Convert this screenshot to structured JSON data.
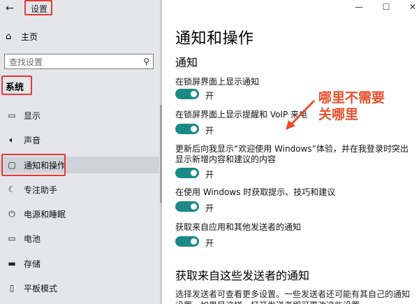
{
  "window": {
    "title": "设置",
    "controls": [
      "—",
      "☐",
      "✕"
    ]
  },
  "sidebar": {
    "back_icon": "back-arrow-icon",
    "home_label": "主页",
    "search_placeholder": "查找设置",
    "section_label": "系统",
    "items": [
      {
        "label": "显示",
        "icon": "display-icon"
      },
      {
        "label": "声音",
        "icon": "speaker-icon"
      },
      {
        "label": "通知和操作",
        "icon": "notification-icon",
        "active": true
      },
      {
        "label": "专注助手",
        "icon": "moon-icon"
      },
      {
        "label": "电源和睡眠",
        "icon": "power-icon"
      },
      {
        "label": "电池",
        "icon": "battery-icon"
      },
      {
        "label": "存储",
        "icon": "storage-icon"
      },
      {
        "label": "平板模式",
        "icon": "tablet-icon"
      }
    ]
  },
  "main": {
    "title": "通知和操作",
    "section_notifications": "通知",
    "settings": [
      {
        "label": "在锁屏界面上显示通知",
        "state": "开"
      },
      {
        "label": "在锁屏界面上显示提醒和 VoIP 来电",
        "state": "开"
      },
      {
        "label": "更新后向我显示“欢迎使用 Windows”体验，并在我登录时突出显示新增内容和建议的内容",
        "state": "开"
      },
      {
        "label": "在使用 Windows 时获取提示、技巧和建议",
        "state": "开"
      },
      {
        "label": "获取来自应用和其他发送者的通知",
        "state": "开"
      }
    ],
    "section_senders": "获取来自这些发送者的通知",
    "senders_desc": "选择发送者可查看更多设置。一些发送者还可能有其自己的通知设置。如果是这样，打开发送者即可更改这些设置。"
  },
  "annotation": {
    "line1": "哪里不需要",
    "line2": "关哪里",
    "color": "#e8502e"
  },
  "colors": {
    "accent_toggle": "#1b8a86",
    "highlight_box": "#e53935",
    "sidebar_bg": "#e4e6ea"
  }
}
